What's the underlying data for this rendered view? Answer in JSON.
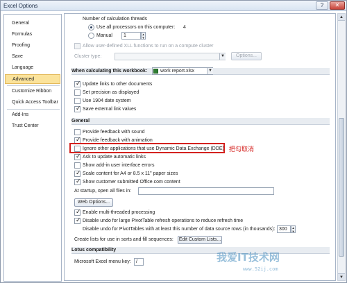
{
  "window": {
    "title": "Excel Options",
    "help_icon": "?",
    "close_icon": "✕"
  },
  "sidebar": {
    "items": [
      {
        "label": "General",
        "active": false
      },
      {
        "label": "Formulas",
        "active": false
      },
      {
        "label": "Proofing",
        "active": false
      },
      {
        "label": "Save",
        "active": false
      },
      {
        "label": "Language",
        "active": false
      },
      {
        "label": "Advanced",
        "active": true
      },
      {
        "label": "Customize Ribbon",
        "active": false
      },
      {
        "label": "Quick Access Toolbar",
        "active": false
      },
      {
        "label": "Add-Ins",
        "active": false
      },
      {
        "label": "Trust Center",
        "active": false
      }
    ]
  },
  "threads": {
    "heading": "Number of calculation threads",
    "all_processors": "Use all processors on this computer:",
    "processor_count": "4",
    "manual": "Manual",
    "manual_value": "1"
  },
  "xll": {
    "allow_label": "Allow user-defined XLL functions to run on a compute cluster",
    "cluster_type_label": "Cluster type:",
    "options_button": "Options..."
  },
  "workbook": {
    "heading": "When calculating this workbook:",
    "selected": "work report.xlsx",
    "options": [
      {
        "label": "Update links to other documents",
        "checked": true
      },
      {
        "label": "Set precision as displayed",
        "checked": false
      },
      {
        "label": "Use 1904 date system",
        "checked": false
      },
      {
        "label": "Save external link values",
        "checked": true
      }
    ]
  },
  "general": {
    "heading": "General",
    "options": [
      {
        "label": "Provide feedback with sound",
        "checked": false
      },
      {
        "label": "Provide feedback with animation",
        "checked": true
      },
      {
        "label": "Ignore other applications that use Dynamic Data Exchange (DDE)",
        "checked": false
      },
      {
        "label": "Ask to update automatic links",
        "checked": true
      },
      {
        "label": "Show add-in user interface errors",
        "checked": false
      },
      {
        "label": "Scale content for A4 or 8.5 x 11\" paper sizes",
        "checked": true
      },
      {
        "label": "Show customer submitted Office.com content",
        "checked": true
      }
    ],
    "startup_label": "At startup, open all files in:",
    "startup_value": "",
    "web_options_button": "Web Options...",
    "multithreaded_label": "Enable multi-threaded processing",
    "multithreaded_checked": true,
    "undo_pivot_label": "Disable undo for large PivotTable refresh operations to reduce refresh time",
    "undo_pivot_checked": true,
    "undo_rows_label": "Disable undo for PivotTables with at least this number of data source rows (in thousands):",
    "undo_rows_value": "300",
    "sort_lists_label": "Create lists for use in sorts and fill sequences:",
    "edit_lists_button": "Edit Custom Lists..."
  },
  "lotus": {
    "heading": "Lotus compatibility",
    "menu_key_label": "Microsoft Excel menu key:",
    "menu_key_value": "/"
  },
  "annotation": {
    "text": "把勾取消",
    "color": "#d4221f"
  },
  "watermark": {
    "text": "我爱IT技术网",
    "sub": "www.52ij.com"
  }
}
